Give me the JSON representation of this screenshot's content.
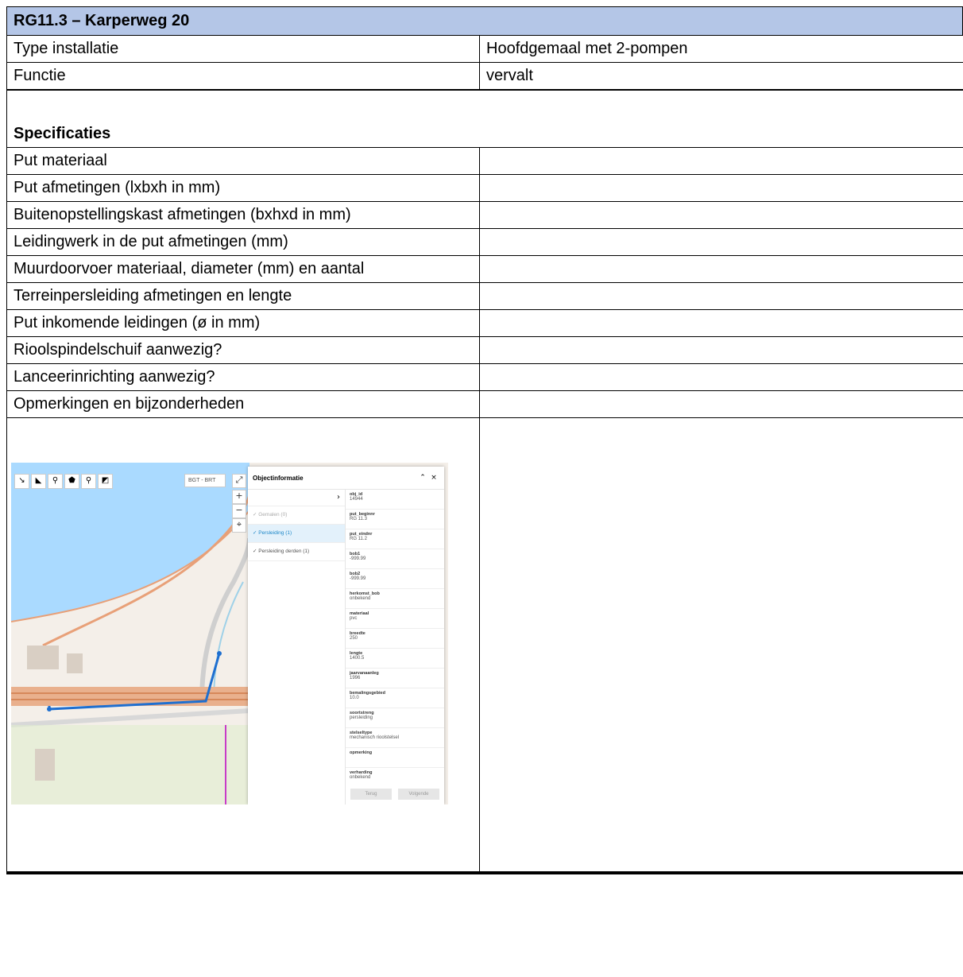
{
  "header": {
    "title": "RG11.3  – Karperweg 20"
  },
  "info_rows": [
    {
      "label": "Type installatie",
      "value": "Hoofdgemaal met 2-pompen"
    },
    {
      "label": "Functie",
      "value": "vervalt"
    },
    {
      "label": "",
      "value": ""
    }
  ],
  "specs": {
    "title": "Specificaties",
    "rows": [
      {
        "label": "Put materiaal",
        "value": ""
      },
      {
        "label": "Put afmetingen (lxbxh in mm)",
        "value": ""
      },
      {
        "label": "Buitenopstellingskast afmetingen (bxhxd in mm)",
        "value": ""
      },
      {
        "label": "Leidingwerk in de put afmetingen (mm)",
        "value": ""
      },
      {
        "label": "Muurdoorvoer materiaal, diameter (mm) en aantal",
        "value": ""
      },
      {
        "label": "Terreinpersleiding afmetingen en lengte",
        "value": ""
      },
      {
        "label": "Put inkomende leidingen (ø in mm)",
        "value": ""
      },
      {
        "label": "Rioolspindelschuif aanwezig?",
        "value": ""
      },
      {
        "label": "Lanceerinrichting aanwezig?",
        "value": ""
      },
      {
        "label": "Opmerkingen en bijzonderheden",
        "value": ""
      }
    ]
  },
  "map": {
    "layer_select": "BGT - BRT",
    "panel_title": "Objectinformatie",
    "layers": [
      {
        "label": "✓ Gemalen (0)",
        "state": "dis"
      },
      {
        "label": "✓ Persleiding (1)",
        "state": "sel"
      },
      {
        "label": "✓ Persleiding derden (1)",
        "state": ""
      }
    ],
    "attributes": [
      {
        "key": "obj_id",
        "value": "14944"
      },
      {
        "key": "put_beginnr",
        "value": "RG 11.3"
      },
      {
        "key": "put_eindnr",
        "value": "RG 11.2"
      },
      {
        "key": "bob1",
        "value": "-999.99"
      },
      {
        "key": "bob2",
        "value": "-999.99"
      },
      {
        "key": "herkomst_bob",
        "value": "onbekend"
      },
      {
        "key": "materiaal",
        "value": "pvc"
      },
      {
        "key": "breedte",
        "value": "250"
      },
      {
        "key": "lengte",
        "value": "1400.5"
      },
      {
        "key": "jaarvanaanleg",
        "value": "1996"
      },
      {
        "key": "bemalingsgebied",
        "value": "10.0"
      },
      {
        "key": "soortstreng",
        "value": "persleiding"
      },
      {
        "key": "stelseltype",
        "value": "mechanisch rioolstelsel"
      },
      {
        "key": "opmerking",
        "value": ""
      },
      {
        "key": "verharding",
        "value": "onbekend"
      }
    ],
    "back_label": "Terug",
    "next_label": "Volgende",
    "colors": {
      "water": "#aadaff",
      "pipe": "#1e6fd0",
      "road": "#e8a078",
      "panel_selected": "#e3f1fb"
    }
  },
  "footer_rows": [
    {
      "label": "",
      "value": ""
    },
    {
      "label": "",
      "value": ""
    },
    {
      "label": "",
      "value": ""
    }
  ]
}
